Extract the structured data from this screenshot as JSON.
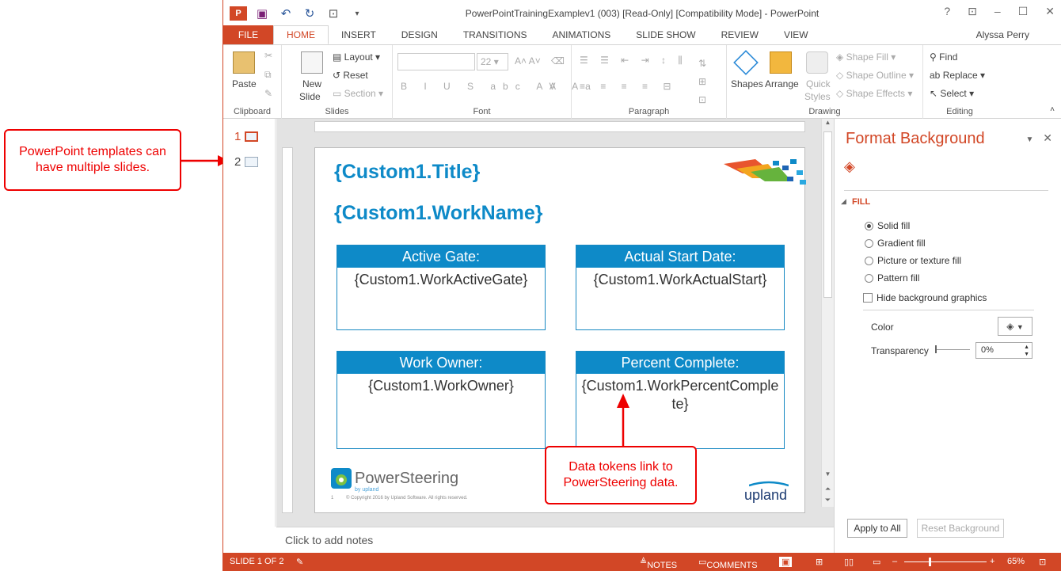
{
  "annotations": {
    "templates": "PowerPoint templates can have multiple slides.",
    "tokens": "Data tokens link to PowerSteering data."
  },
  "window": {
    "title": "PowerPointTrainingExamplev1 (003) [Read-Only] [Compatibility Mode] - PowerPoint",
    "user": "Alyssa Perry"
  },
  "tabs": [
    "FILE",
    "HOME",
    "INSERT",
    "DESIGN",
    "TRANSITIONS",
    "ANIMATIONS",
    "SLIDE SHOW",
    "REVIEW",
    "VIEW"
  ],
  "ribbon": {
    "clipboard": {
      "label": "Clipboard",
      "paste": "Paste"
    },
    "slides": {
      "label": "Slides",
      "new_slide": "New",
      "new_slide2": "Slide",
      "layout": "Layout",
      "reset": "Reset",
      "section": "Section"
    },
    "font": {
      "label": "Font",
      "size": "22"
    },
    "paragraph": {
      "label": "Paragraph"
    },
    "drawing": {
      "label": "Drawing",
      "shapes": "Shapes",
      "arrange": "Arrange",
      "quick": "Quick",
      "styles": "Styles",
      "shape_fill": "Shape Fill",
      "shape_outline": "Shape Outline",
      "shape_effects": "Shape Effects"
    },
    "editing": {
      "label": "Editing",
      "find": "Find",
      "replace": "Replace",
      "select": "Select"
    }
  },
  "thumbnails": [
    "1",
    "2"
  ],
  "slide": {
    "title": "{Custom1.Title}",
    "workname": "{Custom1.WorkName}",
    "cards": [
      {
        "header": "Active Gate:",
        "body": "{Custom1.WorkActiveGate}"
      },
      {
        "header": "Actual Start Date:",
        "body": "{Custom1.WorkActualStart}"
      },
      {
        "header": "Work Owner:",
        "body": "{Custom1.WorkOwner}"
      },
      {
        "header": "Percent Complete:",
        "body": "{Custom1.WorkPercentComplete}"
      }
    ],
    "logo": "PowerSteering",
    "logo_sub": "by upland",
    "copyright": "© Copyright 2016 by Upland Software. All rights reserved.",
    "page_num": "1",
    "upland": "upland"
  },
  "notes": "Click to add notes",
  "format_pane": {
    "title": "Format Background",
    "section": "FILL",
    "options": [
      "Solid fill",
      "Gradient fill",
      "Picture or texture fill",
      "Pattern fill"
    ],
    "hide_graphics": "Hide background graphics",
    "color_label": "Color",
    "transparency_label": "Transparency",
    "transparency_value": "0%",
    "apply_all": "Apply to All",
    "reset": "Reset Background"
  },
  "status": {
    "slide": "SLIDE 1 OF 2",
    "notes": "NOTES",
    "comments": "COMMENTS",
    "zoom": "65%"
  },
  "colors": {
    "accent": "#d24726",
    "slide_blue": "#0e8ac8",
    "annotation": "#ee0000"
  }
}
